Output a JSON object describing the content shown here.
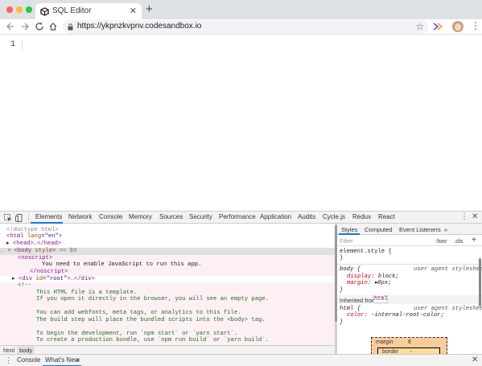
{
  "browser": {
    "tab_title": "SQL Editor",
    "tab_close": "✕",
    "new_tab": "+",
    "url": "https://ykpnzkvpnv.codesandbox.io",
    "star": "☆",
    "menu": "⋮"
  },
  "editor": {
    "line_number": "1"
  },
  "devtools": {
    "tabs": [
      "Elements",
      "Network",
      "Console",
      "Memory",
      "Sources",
      "Security",
      "Performance",
      "Application",
      "Audits",
      "Cycle.js",
      "Redux",
      "React"
    ],
    "active_tab": "Elements",
    "menu": "⋮",
    "close": "✕",
    "elements": {
      "doctype": "<!doctype html>",
      "html_open_tag": "html",
      "html_lang_attr": "lang",
      "html_lang_val": "\"en\"",
      "head_line": "<head>…</head>",
      "body_line_tag": "body",
      "body_attr": "style",
      "selected_marker": "== $0",
      "noscript_open": "<noscript>",
      "noscript_text": "You need to enable JavaScript to run this app.",
      "noscript_close": "</noscript>",
      "div_tag": "div",
      "div_attr": "id",
      "div_val": "\"root\"",
      "div_rest": "…</div>",
      "comment_open": "<!--",
      "comment_lines": [
        "This HTML file is a template.",
        "If you open it directly in the browser, you will see an empty page.",
        "",
        "You can add webfonts, meta tags, or analytics to this file.",
        "The build step will place the bundled scripts into the <body> tag.",
        "",
        "To begin the development, run `npm start` or `yarn start`.",
        "To create a production bundle, use `npm run build` or `yarn build`."
      ]
    },
    "breadcrumb": [
      "html",
      "body"
    ],
    "styles": {
      "tabs": [
        "Styles",
        "Computed",
        "Event Listeners",
        "»"
      ],
      "filter_placeholder": "Filter",
      "hov": ":hov",
      "cls": ".cls",
      "plus": "+",
      "element_style": "element.style {",
      "close_brace": "}",
      "body_selector": "body {",
      "ua_label": "user agent stylesheet",
      "body_props": [
        {
          "name": "display",
          "value": "block;"
        },
        {
          "name": "margin",
          "value": "8px;"
        }
      ],
      "margin_arrow": "▸",
      "inherited_label": "Inherited from",
      "inherited_tag": "html",
      "html_selector": "html {",
      "html_prop_name": "color",
      "html_prop_value": "-internal-root-color;",
      "box_model": {
        "margin_label": "margin",
        "margin_value": "8",
        "border_label": "border",
        "border_value": "-"
      }
    },
    "drawer": {
      "tabs": [
        "Console",
        "What's New"
      ],
      "active_tab": "What's New",
      "tab_close": "✕",
      "close": "✕",
      "menu": "⋮"
    }
  },
  "colors": {
    "accent": "#1a73e8",
    "tag": "#881280",
    "attr": "#994500",
    "attr_value": "#1a1aa6",
    "comment": "#236e25",
    "css_prop": "#c80000"
  }
}
